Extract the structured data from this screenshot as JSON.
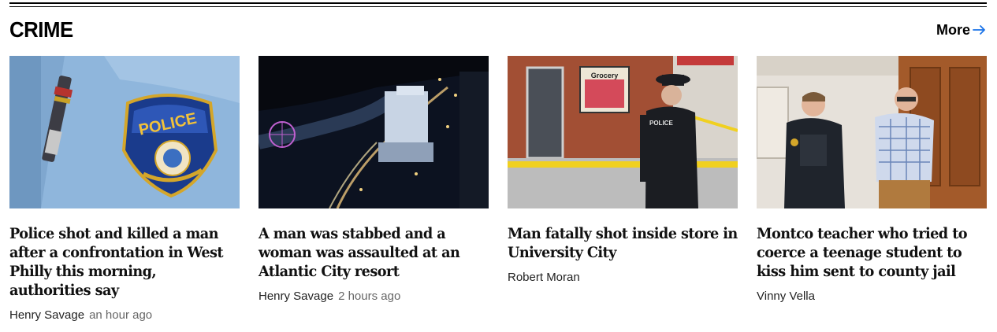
{
  "section": {
    "title": "CRIME",
    "more_label": "More",
    "accent_color": "#1a73e8"
  },
  "stories": [
    {
      "headline": "Police shot and killed a man after a confrontation in West Philly this morning, authorities say",
      "author": "Henry Savage",
      "time": "an hour ago",
      "image": "police-shoulder-patch-photo"
    },
    {
      "headline": "A man was stabbed and a woman was assaulted at an Atlantic City resort",
      "author": "Henry Savage",
      "time": "2 hours ago",
      "image": "atlantic-city-night-aerial-photo"
    },
    {
      "headline": "Man fatally shot inside store in University City",
      "author": "Robert Moran",
      "time": "",
      "image": "police-officer-at-store-photo"
    },
    {
      "headline": "Montco teacher who tried to coerce a teenage student to kiss him sent to county jail",
      "author": "Vinny Vella",
      "time": "",
      "image": "teacher-escorted-by-officer-photo"
    }
  ]
}
